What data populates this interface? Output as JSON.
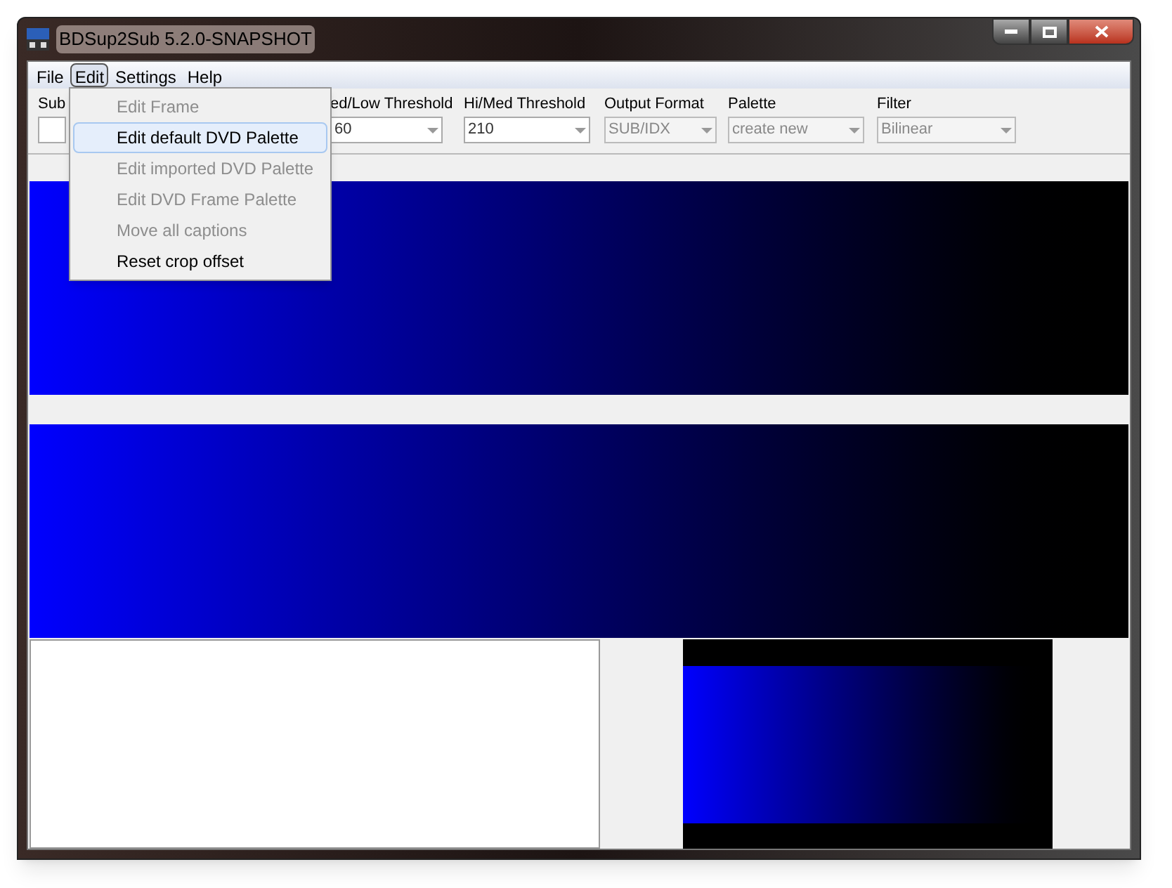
{
  "window": {
    "title": "BDSup2Sub 5.2.0-SNAPSHOT"
  },
  "menu_bar": [
    {
      "label": "File",
      "selected": false
    },
    {
      "label": "Edit",
      "selected": true
    },
    {
      "label": "Settings",
      "selected": false
    },
    {
      "label": "Help",
      "selected": false
    }
  ],
  "edit_menu": [
    {
      "label": "Edit Frame",
      "disabled": true,
      "selected": false
    },
    {
      "label": "Edit default DVD Palette",
      "disabled": false,
      "selected": true
    },
    {
      "label": "Edit imported DVD Palette",
      "disabled": true,
      "selected": false
    },
    {
      "label": "Edit DVD Frame Palette",
      "disabled": true,
      "selected": false
    },
    {
      "label": "Move all captions",
      "disabled": true,
      "selected": false
    },
    {
      "label": "Reset crop offset",
      "disabled": false,
      "selected": false
    }
  ],
  "toolbar": [
    {
      "label": "Sub",
      "disabled": false
    },
    {
      "label": "ed/Low Threshold",
      "value": "60",
      "disabled": false
    },
    {
      "label": "Hi/Med Threshold",
      "value": "210",
      "disabled": false
    },
    {
      "label": "Output Format",
      "value": "SUB/IDX",
      "disabled": true
    },
    {
      "label": "Palette",
      "value": "create new",
      "disabled": true
    },
    {
      "label": "Filter",
      "value": "Bilinear",
      "disabled": true
    }
  ]
}
